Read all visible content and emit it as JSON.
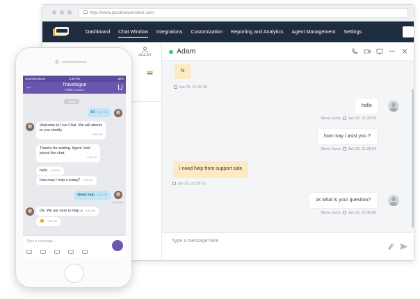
{
  "browser": {
    "url": "http://www.jacobsawensten.com"
  },
  "nav": {
    "items": [
      {
        "label": "Dashboard"
      },
      {
        "label": "Chat Window"
      },
      {
        "label": "Integrations"
      },
      {
        "label": "Customization"
      },
      {
        "label": "Reporting and Analytics"
      },
      {
        "label": "Agent Management"
      },
      {
        "label": "Settings"
      }
    ],
    "active": "Chat Window"
  },
  "left_pane": {
    "agent_label": "AGENT"
  },
  "chat": {
    "contact_name": "Adam",
    "messages": [
      {
        "text": "hi",
        "direction": "in",
        "meta": "Jan 23, 21:32:26"
      },
      {
        "text": "hello",
        "direction": "out",
        "sender": "Steve Jams,",
        "meta": "Jan 23, 21:32:55"
      },
      {
        "text": "how may i asist you ?",
        "direction": "out",
        "sender": "Steve Jams,",
        "meta": "Jan 23, 21:36:04"
      },
      {
        "text": "i need help from support side",
        "direction": "in",
        "meta": "Jan 23, 21:39:15"
      },
      {
        "text": "ok what is your question?",
        "direction": "out",
        "sender": "Steve Jams,",
        "meta": "Jan 23, 21:40:00"
      }
    ],
    "composer_placeholder": "Type a message here"
  },
  "phone": {
    "carrier": "Grameenphone",
    "time": "4:36 PM",
    "battery": "60%",
    "contact": "Travelogue",
    "subtitle": "Public Account",
    "today_label": "Today",
    "messages": [
      {
        "text": "Hi",
        "time": "4:35 PM",
        "side": "right"
      },
      {
        "text": "Welcome to Live Chat. We will attend to you shortly.",
        "time": "4:35 PM",
        "side": "left"
      },
      {
        "text": "Thanks for waiting. Agent Jack joined the chat.",
        "time": "4:35 PM",
        "side": "left"
      },
      {
        "text": "hello",
        "time": "4:35 PM",
        "side": "left"
      },
      {
        "text": "how may I help u today?",
        "time": "4:36 PM",
        "side": "left"
      },
      {
        "text": "Need help",
        "time": "4:36 PM",
        "side": "right"
      },
      {
        "text": "Ok. We are here to help u",
        "time": "4:36 PM",
        "side": "left"
      },
      {
        "text": "😊",
        "time": "4:36 PM",
        "side": "left"
      }
    ],
    "delivered_label": "Delivered",
    "input_placeholder": "Type a message..."
  }
}
